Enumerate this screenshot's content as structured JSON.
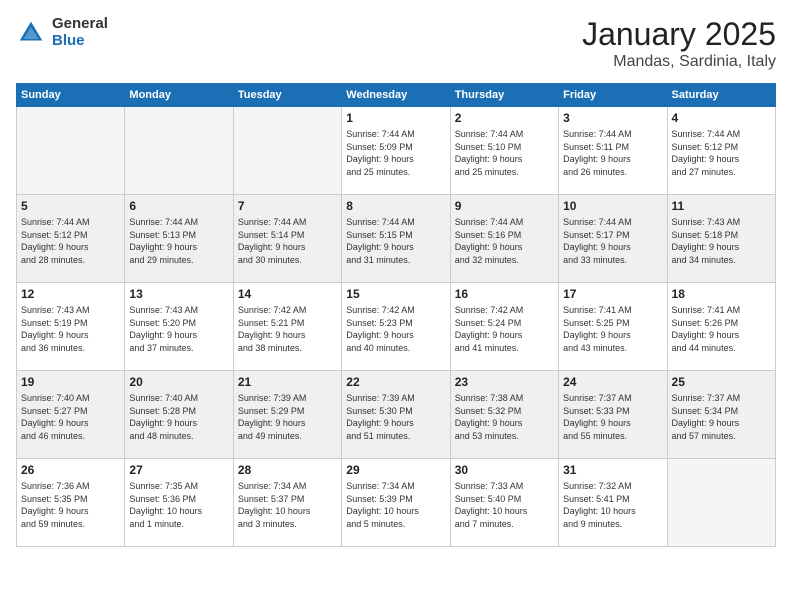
{
  "logo": {
    "general": "General",
    "blue": "Blue"
  },
  "header": {
    "month": "January 2025",
    "location": "Mandas, Sardinia, Italy"
  },
  "weekdays": [
    "Sunday",
    "Monday",
    "Tuesday",
    "Wednesday",
    "Thursday",
    "Friday",
    "Saturday"
  ],
  "weeks": [
    [
      {
        "day": "",
        "empty": true,
        "info": ""
      },
      {
        "day": "",
        "empty": true,
        "info": ""
      },
      {
        "day": "",
        "empty": true,
        "info": ""
      },
      {
        "day": "1",
        "empty": false,
        "info": "Sunrise: 7:44 AM\nSunset: 5:09 PM\nDaylight: 9 hours\nand 25 minutes."
      },
      {
        "day": "2",
        "empty": false,
        "info": "Sunrise: 7:44 AM\nSunset: 5:10 PM\nDaylight: 9 hours\nand 25 minutes."
      },
      {
        "day": "3",
        "empty": false,
        "info": "Sunrise: 7:44 AM\nSunset: 5:11 PM\nDaylight: 9 hours\nand 26 minutes."
      },
      {
        "day": "4",
        "empty": false,
        "info": "Sunrise: 7:44 AM\nSunset: 5:12 PM\nDaylight: 9 hours\nand 27 minutes."
      }
    ],
    [
      {
        "day": "5",
        "empty": false,
        "info": "Sunrise: 7:44 AM\nSunset: 5:12 PM\nDaylight: 9 hours\nand 28 minutes."
      },
      {
        "day": "6",
        "empty": false,
        "info": "Sunrise: 7:44 AM\nSunset: 5:13 PM\nDaylight: 9 hours\nand 29 minutes."
      },
      {
        "day": "7",
        "empty": false,
        "info": "Sunrise: 7:44 AM\nSunset: 5:14 PM\nDaylight: 9 hours\nand 30 minutes."
      },
      {
        "day": "8",
        "empty": false,
        "info": "Sunrise: 7:44 AM\nSunset: 5:15 PM\nDaylight: 9 hours\nand 31 minutes."
      },
      {
        "day": "9",
        "empty": false,
        "info": "Sunrise: 7:44 AM\nSunset: 5:16 PM\nDaylight: 9 hours\nand 32 minutes."
      },
      {
        "day": "10",
        "empty": false,
        "info": "Sunrise: 7:44 AM\nSunset: 5:17 PM\nDaylight: 9 hours\nand 33 minutes."
      },
      {
        "day": "11",
        "empty": false,
        "info": "Sunrise: 7:43 AM\nSunset: 5:18 PM\nDaylight: 9 hours\nand 34 minutes."
      }
    ],
    [
      {
        "day": "12",
        "empty": false,
        "info": "Sunrise: 7:43 AM\nSunset: 5:19 PM\nDaylight: 9 hours\nand 36 minutes."
      },
      {
        "day": "13",
        "empty": false,
        "info": "Sunrise: 7:43 AM\nSunset: 5:20 PM\nDaylight: 9 hours\nand 37 minutes."
      },
      {
        "day": "14",
        "empty": false,
        "info": "Sunrise: 7:42 AM\nSunset: 5:21 PM\nDaylight: 9 hours\nand 38 minutes."
      },
      {
        "day": "15",
        "empty": false,
        "info": "Sunrise: 7:42 AM\nSunset: 5:23 PM\nDaylight: 9 hours\nand 40 minutes."
      },
      {
        "day": "16",
        "empty": false,
        "info": "Sunrise: 7:42 AM\nSunset: 5:24 PM\nDaylight: 9 hours\nand 41 minutes."
      },
      {
        "day": "17",
        "empty": false,
        "info": "Sunrise: 7:41 AM\nSunset: 5:25 PM\nDaylight: 9 hours\nand 43 minutes."
      },
      {
        "day": "18",
        "empty": false,
        "info": "Sunrise: 7:41 AM\nSunset: 5:26 PM\nDaylight: 9 hours\nand 44 minutes."
      }
    ],
    [
      {
        "day": "19",
        "empty": false,
        "info": "Sunrise: 7:40 AM\nSunset: 5:27 PM\nDaylight: 9 hours\nand 46 minutes."
      },
      {
        "day": "20",
        "empty": false,
        "info": "Sunrise: 7:40 AM\nSunset: 5:28 PM\nDaylight: 9 hours\nand 48 minutes."
      },
      {
        "day": "21",
        "empty": false,
        "info": "Sunrise: 7:39 AM\nSunset: 5:29 PM\nDaylight: 9 hours\nand 49 minutes."
      },
      {
        "day": "22",
        "empty": false,
        "info": "Sunrise: 7:39 AM\nSunset: 5:30 PM\nDaylight: 9 hours\nand 51 minutes."
      },
      {
        "day": "23",
        "empty": false,
        "info": "Sunrise: 7:38 AM\nSunset: 5:32 PM\nDaylight: 9 hours\nand 53 minutes."
      },
      {
        "day": "24",
        "empty": false,
        "info": "Sunrise: 7:37 AM\nSunset: 5:33 PM\nDaylight: 9 hours\nand 55 minutes."
      },
      {
        "day": "25",
        "empty": false,
        "info": "Sunrise: 7:37 AM\nSunset: 5:34 PM\nDaylight: 9 hours\nand 57 minutes."
      }
    ],
    [
      {
        "day": "26",
        "empty": false,
        "info": "Sunrise: 7:36 AM\nSunset: 5:35 PM\nDaylight: 9 hours\nand 59 minutes."
      },
      {
        "day": "27",
        "empty": false,
        "info": "Sunrise: 7:35 AM\nSunset: 5:36 PM\nDaylight: 10 hours\nand 1 minute."
      },
      {
        "day": "28",
        "empty": false,
        "info": "Sunrise: 7:34 AM\nSunset: 5:37 PM\nDaylight: 10 hours\nand 3 minutes."
      },
      {
        "day": "29",
        "empty": false,
        "info": "Sunrise: 7:34 AM\nSunset: 5:39 PM\nDaylight: 10 hours\nand 5 minutes."
      },
      {
        "day": "30",
        "empty": false,
        "info": "Sunrise: 7:33 AM\nSunset: 5:40 PM\nDaylight: 10 hours\nand 7 minutes."
      },
      {
        "day": "31",
        "empty": false,
        "info": "Sunrise: 7:32 AM\nSunset: 5:41 PM\nDaylight: 10 hours\nand 9 minutes."
      },
      {
        "day": "",
        "empty": true,
        "info": ""
      }
    ]
  ]
}
